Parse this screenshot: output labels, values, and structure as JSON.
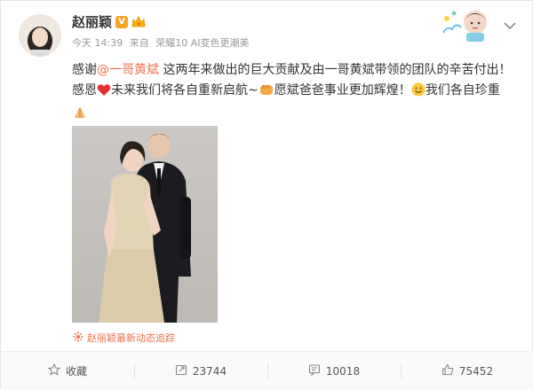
{
  "post": {
    "username": "赵丽颖",
    "verified_badge": "V",
    "meta": {
      "time": "今天 14:39",
      "from_label": "来自",
      "device": "荣耀10 AI变色更潮美"
    },
    "text": {
      "part1": "感谢",
      "mention": "@一哥黄斌",
      "part2": " 这两年来做出的巨大贡献及由一哥黄斌带领的团队的辛苦付出！",
      "part3": "感恩",
      "part4": "未来我们将各自重新启航~",
      "part5": "愿斌爸爸事业更加辉煌！",
      "part6": "我们各自珍重"
    },
    "source_link": "赵丽颖最新动态追踪"
  },
  "actions": {
    "favorite_label": "收藏",
    "repost_count": "23744",
    "comment_count": "10018",
    "like_count": "75452"
  },
  "colors": {
    "accent": "#eb7350",
    "text": "#333333",
    "muted": "#999999"
  },
  "icons": [
    "star-icon",
    "repost-icon",
    "comment-icon",
    "thumb-up-icon",
    "chevron-down-icon",
    "heart-icon",
    "fist-icon",
    "smile-icon",
    "pray-icon",
    "link-icon"
  ]
}
